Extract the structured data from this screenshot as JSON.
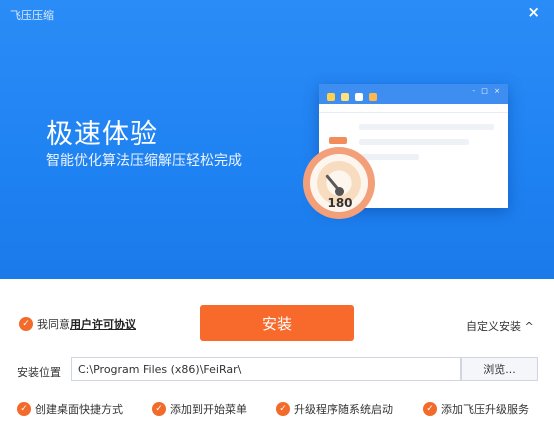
{
  "window": {
    "title": "飞压压缩",
    "close_glyph": "×"
  },
  "banner": {
    "headline": "极速体验",
    "subline": "智能优化算法压缩解压轻松完成",
    "gauge_value": "180",
    "mock_window_dots": "- □ ×"
  },
  "agreement": {
    "prefix": "我同意",
    "link": "用户许可协议"
  },
  "install_button": "安装",
  "custom_install": "自定义安装 ^",
  "location": {
    "label": "安装位置",
    "path": "C:\\Program Files (x86)\\FeiRar\\"
  },
  "browse_button": "浏览...",
  "options": [
    {
      "label": "创建桌面快捷方式"
    },
    {
      "label": "添加到开始菜单"
    },
    {
      "label": "升级程序随系统启动"
    },
    {
      "label": "添加飞压升级服务"
    }
  ],
  "check_glyph": "✓",
  "colors": {
    "banner": "#2088f4",
    "accent": "#f76a2c",
    "check": "#f26b2b"
  }
}
